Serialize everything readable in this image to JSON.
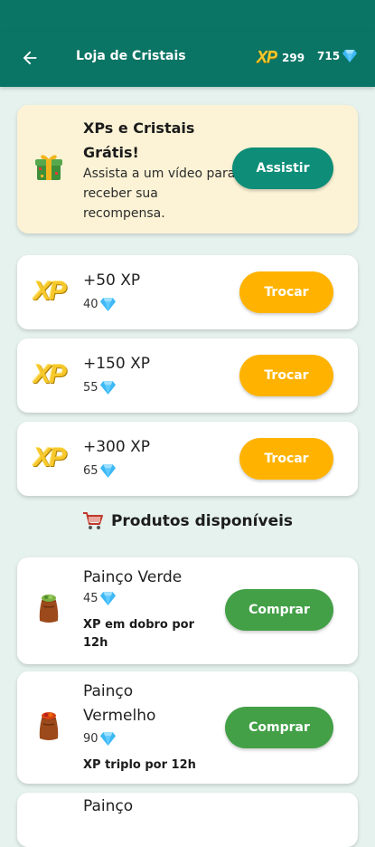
{
  "appbar": {
    "title": "Loja de Cristais",
    "xp_logo": "XP",
    "xp_value": "299",
    "gem_value": "715",
    "back_icon": "arrow-left-icon",
    "gem_icon": "diamond-icon"
  },
  "promo": {
    "title": "XPs e Cristais Grátis!",
    "description": "Assista a um vídeo para receber sua recompensa.",
    "button": "Assistir",
    "icon": "gift-icon"
  },
  "xp_offers": [
    {
      "logo": "XP",
      "title": "+50 XP",
      "price": "40",
      "button": "Trocar"
    },
    {
      "logo": "XP",
      "title": "+150 XP",
      "price": "55",
      "button": "Trocar"
    },
    {
      "logo": "XP",
      "title": "+300 XP",
      "price": "65",
      "button": "Trocar"
    }
  ],
  "products_heading": "Produtos disponíveis",
  "products": [
    {
      "name": "Painço Verde",
      "price": "45",
      "benefit": "XP em dobro por 12h",
      "button": "Comprar",
      "icon": "green-seed-bag-icon"
    },
    {
      "name": "Painço Vermelho",
      "price": "90",
      "benefit": "XP triplo por 12h",
      "button": "Comprar",
      "icon": "red-seed-bag-icon"
    },
    {
      "name": "Painço",
      "icon": "seed-bag-icon"
    }
  ],
  "colors": {
    "primary": "#0b7565",
    "background": "#e6f2ee",
    "promo_background": "#fcf3d6",
    "teal_button": "#0e8d78",
    "orange_button": "#ffb300",
    "green_button": "#43a047",
    "gem": "#3db8f5",
    "xp_gold": "#f6c82b"
  }
}
